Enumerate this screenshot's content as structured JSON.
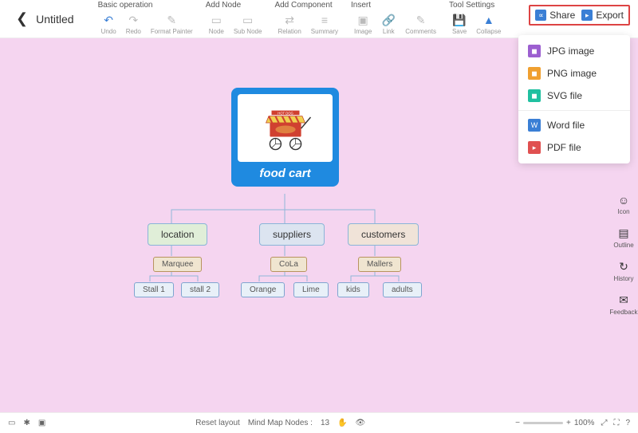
{
  "doc": {
    "title": "Untitled"
  },
  "toolbar": {
    "groups": {
      "basic": {
        "label": "Basic operation",
        "undo": "Undo",
        "redo": "Redo",
        "format_painter": "Format Painter"
      },
      "add_node": {
        "label": "Add Node",
        "node": "Node",
        "sub_node": "Sub Node"
      },
      "add_component": {
        "label": "Add Component",
        "relation": "Relation",
        "summary": "Summary"
      },
      "insert": {
        "label": "Insert",
        "image": "Image",
        "link": "Link",
        "comments": "Comments"
      },
      "tool_settings": {
        "label": "Tool Settings",
        "save": "Save",
        "collapse": "Collapse"
      }
    },
    "share": "Share",
    "export": "Export"
  },
  "export_menu": {
    "jpg": "JPG image",
    "png": "PNG image",
    "svg": "SVG file",
    "word": "Word file",
    "pdf": "PDF file"
  },
  "right_sidebar": {
    "icon": "Icon",
    "outline": "Outline",
    "history": "History",
    "feedback": "Feedback"
  },
  "mindmap": {
    "root": {
      "label": "food cart",
      "image_tag": "HOT DOG"
    },
    "branches": [
      {
        "label": "location",
        "color": "#e0eed8",
        "children": [
          {
            "label": "Marquee",
            "leaves": [
              "Stall 1",
              "stall 2"
            ]
          }
        ]
      },
      {
        "label": "suppliers",
        "color": "#dce4f0",
        "children": [
          {
            "label": "CoLa",
            "leaves": [
              "Orange",
              "Lime"
            ]
          }
        ]
      },
      {
        "label": "customers",
        "color": "#f0e3d8",
        "children": [
          {
            "label": "Mallers",
            "leaves": [
              "kids",
              "adults"
            ]
          }
        ]
      }
    ]
  },
  "statusbar": {
    "reset_layout": "Reset layout",
    "nodes_label": "Mind Map Nodes :",
    "node_count": "13",
    "zoom": "100%"
  },
  "colors": {
    "jpg": "#9c5fd0",
    "png": "#f0a030",
    "svg": "#20c0a0",
    "word": "#3a7fd5",
    "pdf": "#e05050"
  }
}
